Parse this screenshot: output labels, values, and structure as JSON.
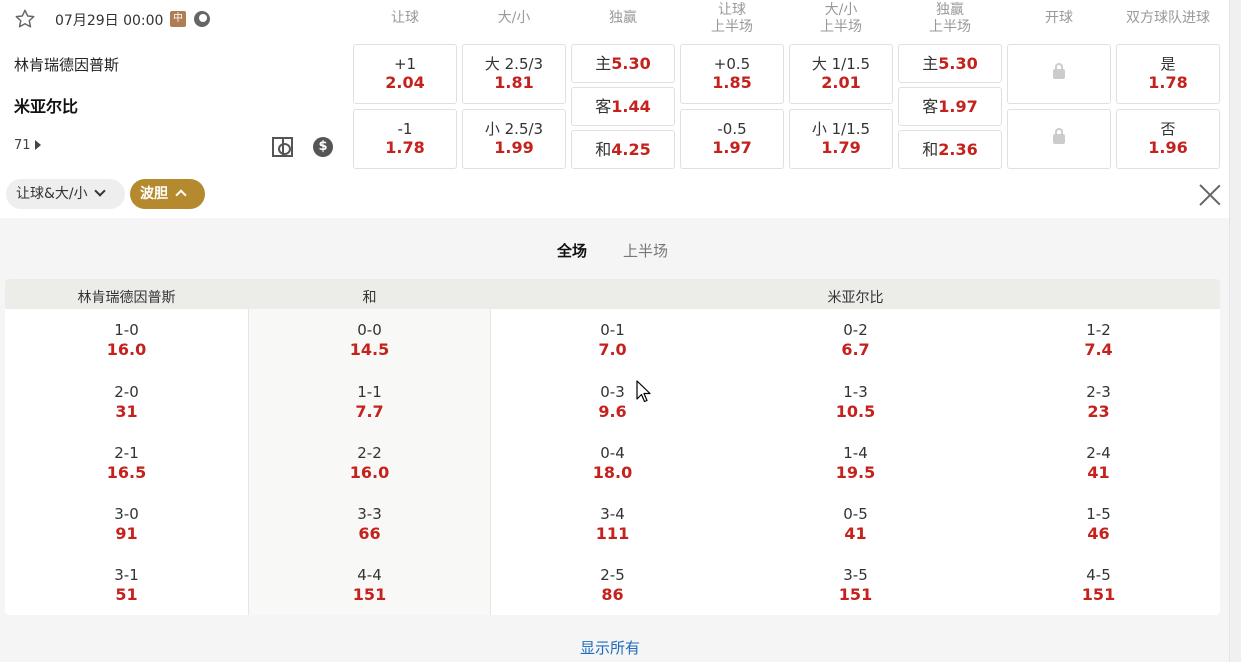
{
  "match": {
    "time": "07月29日 00:00",
    "league_badge": "中",
    "home": "林肯瑞德因普斯",
    "away": "米亚尔比",
    "market_count": "71"
  },
  "columns": [
    {
      "line1": "让球",
      "line2": ""
    },
    {
      "line1": "大/小",
      "line2": ""
    },
    {
      "line1": "独赢",
      "line2": ""
    },
    {
      "line1": "让球",
      "line2": "上半场"
    },
    {
      "line1": "大/小",
      "line2": "上半场"
    },
    {
      "line1": "独赢",
      "line2": "上半场"
    },
    {
      "line1": "开球",
      "line2": ""
    },
    {
      "line1": "双方球队进球",
      "line2": ""
    }
  ],
  "odds": {
    "ah": [
      {
        "label": "+1",
        "value": "2.04"
      },
      {
        "label": "-1",
        "value": "1.78"
      }
    ],
    "ou": [
      {
        "label": "大 2.5/3",
        "value": "1.81"
      },
      {
        "label": "小 2.5/3",
        "value": "1.99"
      }
    ],
    "x12": [
      {
        "label": "主",
        "value": "5.30"
      },
      {
        "label": "客",
        "value": "1.44"
      },
      {
        "label": "和",
        "value": "4.25"
      }
    ],
    "ah_h1": [
      {
        "label": "+0.5",
        "value": "1.85"
      },
      {
        "label": "-0.5",
        "value": "1.97"
      }
    ],
    "ou_h1": [
      {
        "label": "大 1/1.5",
        "value": "2.01"
      },
      {
        "label": "小 1/1.5",
        "value": "1.79"
      }
    ],
    "x12_h1": [
      {
        "label": "主",
        "value": "5.30"
      },
      {
        "label": "客",
        "value": "1.97"
      },
      {
        "label": "和",
        "value": "2.36"
      }
    ],
    "btts": [
      {
        "label": "是",
        "value": "1.78"
      },
      {
        "label": "否",
        "value": "1.96"
      }
    ]
  },
  "filters": {
    "ah_ou": "让球&大/小",
    "correct_score": "波胆"
  },
  "period_tabs": {
    "full": "全场",
    "half": "上半场"
  },
  "correct_score": {
    "headers": {
      "home": "林肯瑞德因普斯",
      "draw": "和",
      "away": "米亚尔比"
    },
    "columns": [
      [
        {
          "score": "1-0",
          "odd": "16.0"
        },
        {
          "score": "2-0",
          "odd": "31"
        },
        {
          "score": "2-1",
          "odd": "16.5"
        },
        {
          "score": "3-0",
          "odd": "91"
        },
        {
          "score": "3-1",
          "odd": "51"
        }
      ],
      [
        {
          "score": "0-0",
          "odd": "14.5"
        },
        {
          "score": "1-1",
          "odd": "7.7"
        },
        {
          "score": "2-2",
          "odd": "16.0"
        },
        {
          "score": "3-3",
          "odd": "66"
        },
        {
          "score": "4-4",
          "odd": "151"
        }
      ],
      [
        {
          "score": "0-1",
          "odd": "7.0"
        },
        {
          "score": "0-3",
          "odd": "9.6"
        },
        {
          "score": "0-4",
          "odd": "18.0"
        },
        {
          "score": "3-4",
          "odd": "111"
        },
        {
          "score": "2-5",
          "odd": "86"
        }
      ],
      [
        {
          "score": "0-2",
          "odd": "6.7"
        },
        {
          "score": "1-3",
          "odd": "10.5"
        },
        {
          "score": "1-4",
          "odd": "19.5"
        },
        {
          "score": "0-5",
          "odd": "41"
        },
        {
          "score": "3-5",
          "odd": "151"
        }
      ],
      [
        {
          "score": "1-2",
          "odd": "7.4"
        },
        {
          "score": "2-3",
          "odd": "23"
        },
        {
          "score": "2-4",
          "odd": "41"
        },
        {
          "score": "1-5",
          "odd": "46"
        },
        {
          "score": "4-5",
          "odd": "151"
        }
      ]
    ]
  },
  "show_all": "显示所有",
  "colors": {
    "odds_red": "#c5211d",
    "gold_pill": "#b58a2e",
    "link_blue": "#1e6bbf"
  }
}
